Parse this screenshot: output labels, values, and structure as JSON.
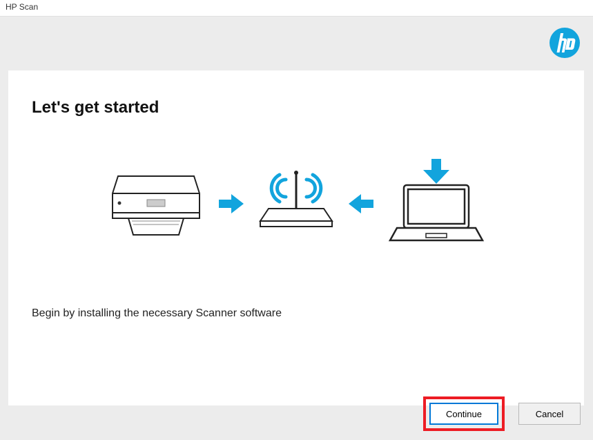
{
  "title_bar": "HP Scan",
  "brand_logo_label": "hp",
  "heading": "Let's get started",
  "instructions": "Begin by installing the necessary Scanner software",
  "icons": {
    "printer": "printer-icon",
    "arrow_right": "arrow-right-icon",
    "router": "router-wifi-icon",
    "arrow_left": "arrow-left-icon",
    "laptop_download": "laptop-download-icon"
  },
  "buttons": {
    "continue": "Continue",
    "cancel": "Cancel"
  },
  "colors": {
    "accent": "#12a4dd",
    "highlight_box": "#ed1c24"
  }
}
